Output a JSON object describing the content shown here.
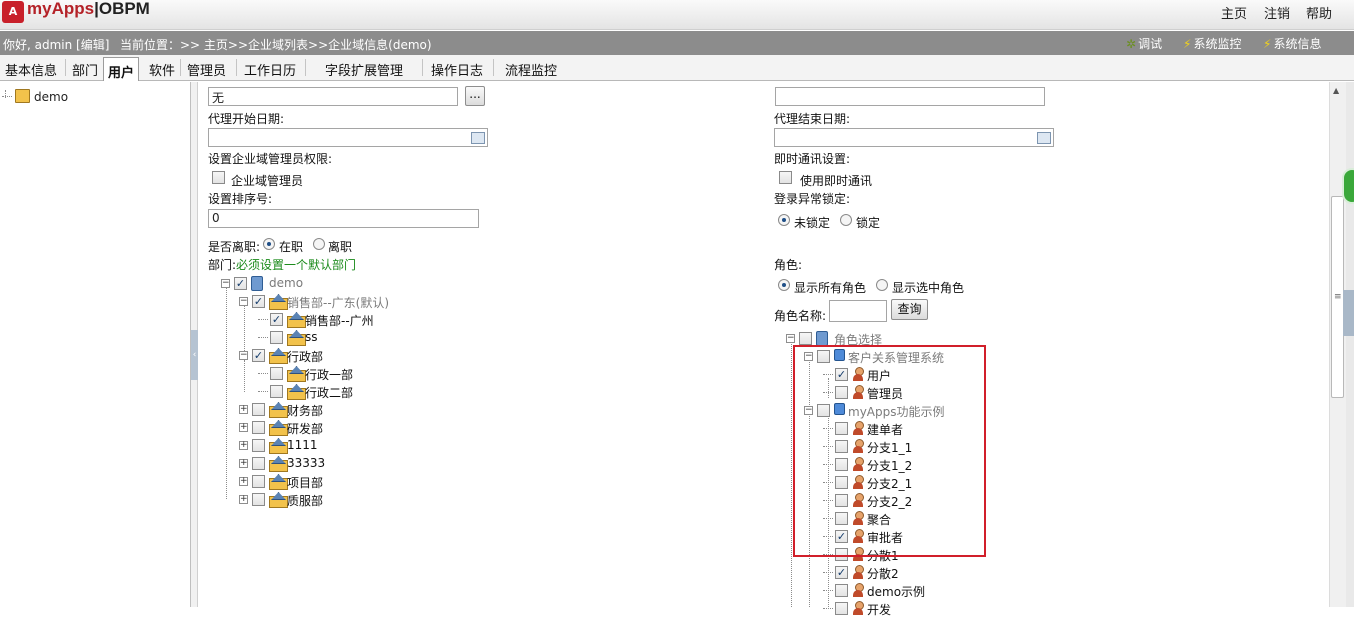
{
  "app": {
    "logo_glyph": "A",
    "name": "myApps",
    "sep": "|",
    "product": "OBPM"
  },
  "top_links": {
    "home": "主页",
    "logout": "注销",
    "help": "帮助"
  },
  "info": {
    "greeting": "你好, admin [编辑]",
    "location": "当前位置：>> 主页>>企业域列表>>企业域信息(demo)",
    "debug": "调试",
    "monitor": "系统监控",
    "sysinfo": "系统信息"
  },
  "tabs": [
    "基本信息",
    "部门",
    "用户",
    "软件",
    "管理员",
    "工作日历",
    "字段扩展管理",
    "操作日志",
    "流程监控"
  ],
  "active_tab": "用户",
  "left_tree": {
    "root": "demo"
  },
  "form": {
    "superior_value": "无",
    "browse_btn": "...",
    "proxy_start_label": "代理开始日期:",
    "proxy_end_label": "代理结束日期:",
    "domain_admin_perm_label": "设置企业域管理员权限:",
    "domain_admin_cb": "企业域管理员",
    "im_label": "即时通讯设置:",
    "im_cb": "使用即时通讯",
    "order_label": "设置排序号:",
    "order_value": "0",
    "lock_label": "登录异常锁定:",
    "unlocked": "未锁定",
    "locked": "锁定",
    "resigned_label": "是否离职:",
    "employed": "在职",
    "resigned": "离职",
    "dept_label": "部门:",
    "dept_hint": "必须设置一个默认部门",
    "role_label": "角色:",
    "show_all_roles": "显示所有角色",
    "show_selected_roles": "显示选中角色",
    "role_name_label": "角色名称:",
    "query_btn": "查询"
  },
  "dept_tree": [
    {
      "label": "demo",
      "level": 0,
      "checked": true,
      "expand": "-",
      "icon": "pc"
    },
    {
      "label": "销售部--广东(默认)",
      "level": 1,
      "checked": true,
      "expand": "-"
    },
    {
      "label": "销售部--广州",
      "level": 2,
      "checked": true,
      "expand": ""
    },
    {
      "label": "ss",
      "level": 2,
      "checked": false,
      "expand": ""
    },
    {
      "label": "行政部",
      "level": 1,
      "checked": true,
      "expand": "-"
    },
    {
      "label": "行政一部",
      "level": 2,
      "checked": false,
      "expand": ""
    },
    {
      "label": "行政二部",
      "level": 2,
      "checked": false,
      "expand": ""
    },
    {
      "label": "财务部",
      "level": 1,
      "checked": false,
      "expand": "+"
    },
    {
      "label": "研发部",
      "level": 1,
      "checked": false,
      "expand": "+"
    },
    {
      "label": "1111",
      "level": 1,
      "checked": false,
      "expand": "+"
    },
    {
      "label": "33333",
      "level": 1,
      "checked": false,
      "expand": "+"
    },
    {
      "label": "项目部",
      "level": 1,
      "checked": false,
      "expand": "+"
    },
    {
      "label": "质服部",
      "level": 1,
      "checked": false,
      "expand": "+"
    }
  ],
  "role_tree": [
    {
      "label": "角色选择",
      "level": 0,
      "checked": false,
      "expand": "-",
      "icon": "pc"
    },
    {
      "label": "客户关系管理系统",
      "level": 1,
      "checked": false,
      "expand": "-",
      "icon": "cube"
    },
    {
      "label": "用户",
      "level": 2,
      "checked": true,
      "icon": "person"
    },
    {
      "label": "管理员",
      "level": 2,
      "checked": false,
      "icon": "person"
    },
    {
      "label": "myApps功能示例",
      "level": 1,
      "checked": false,
      "expand": "-",
      "icon": "cube"
    },
    {
      "label": "建单者",
      "level": 2,
      "checked": false,
      "icon": "person"
    },
    {
      "label": "分支1_1",
      "level": 2,
      "checked": false,
      "icon": "person"
    },
    {
      "label": "分支1_2",
      "level": 2,
      "checked": false,
      "icon": "person"
    },
    {
      "label": "分支2_1",
      "level": 2,
      "checked": false,
      "icon": "person"
    },
    {
      "label": "分支2_2",
      "level": 2,
      "checked": false,
      "icon": "person"
    },
    {
      "label": "聚合",
      "level": 2,
      "checked": false,
      "icon": "person"
    },
    {
      "label": "审批者",
      "level": 2,
      "checked": true,
      "icon": "person"
    },
    {
      "label": "分散1",
      "level": 2,
      "checked": false,
      "icon": "person"
    },
    {
      "label": "分散2",
      "level": 2,
      "checked": true,
      "icon": "person"
    },
    {
      "label": "demo示例",
      "level": 2,
      "checked": false,
      "icon": "person"
    },
    {
      "label": "开发",
      "level": 2,
      "checked": false,
      "icon": "person"
    }
  ],
  "colors": {
    "highlight": "#d11f2a",
    "hint": "#1a8a1a"
  }
}
